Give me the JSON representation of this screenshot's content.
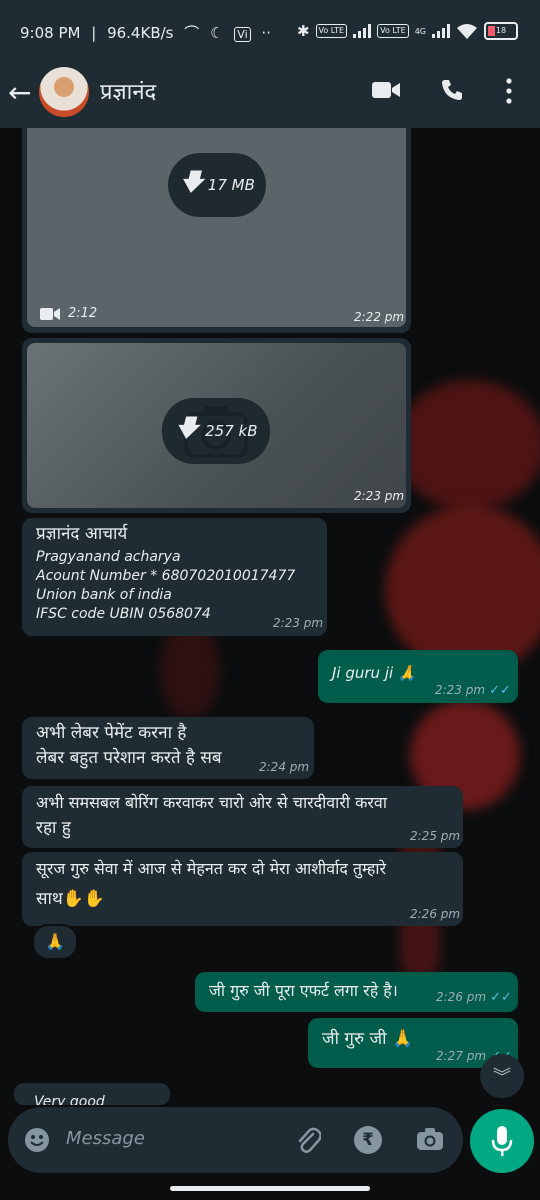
{
  "status_bar": {
    "time": "9:08 PM",
    "speed": "96.4KB/s",
    "volte1": "Vo LTE",
    "volte2": "Vo LTE",
    "network": "4G",
    "battery": "18"
  },
  "header": {
    "contact_name": "प्रज्ञानंद"
  },
  "media": [
    {
      "type": "video",
      "size": "17 MB",
      "duration": "2:12",
      "time": "2:22 pm"
    },
    {
      "type": "photo",
      "size": "257 kB",
      "time": "2:23 pm"
    }
  ],
  "messages": {
    "bank_name": "प्रज्ञानंद आचार्य",
    "bank_line1": "Pragyanand acharya",
    "bank_line2": "Acount Number * 680702010017477",
    "bank_line3": "Union bank of india",
    "bank_line4": "IFSC code UBIN 0568074",
    "bank_time": "2:23 pm",
    "out1_text": "Ji guru ji 🙏",
    "out1_time": "2:23 pm",
    "in2_line1": "अभी लेबर पेमेंट करना है",
    "in2_line2": "लेबर बहुत परेशान करते है सब",
    "in2_time": "2:24 pm",
    "in3_line1": "अभी समसबल बोरिंग करवाकर चारो ओर से चारदीवारी करवा",
    "in3_line2": "रहा हु",
    "in3_time": "2:25 pm",
    "in4_line1": "सूरज गुरु सेवा में आज से मेहनत कर दो मेरा आशीर्वाद तुम्हारे",
    "in4_line2": "साथ✋✋",
    "in4_time": "2:26 pm",
    "reaction": "🙏",
    "out2_text": "जी गुरु जी पूरा एफर्ट लगा रहे है।",
    "out2_time": "2:26 pm",
    "out3_text": "जी गुरु जी 🙏",
    "out3_time": "2:27 pm",
    "in5_partial": "Very good"
  },
  "input": {
    "placeholder": "Message"
  },
  "colors": {
    "incoming": "#202c33",
    "outgoing": "#005c4b",
    "accent": "#00a884",
    "read_ticks": "#53bdeb"
  }
}
